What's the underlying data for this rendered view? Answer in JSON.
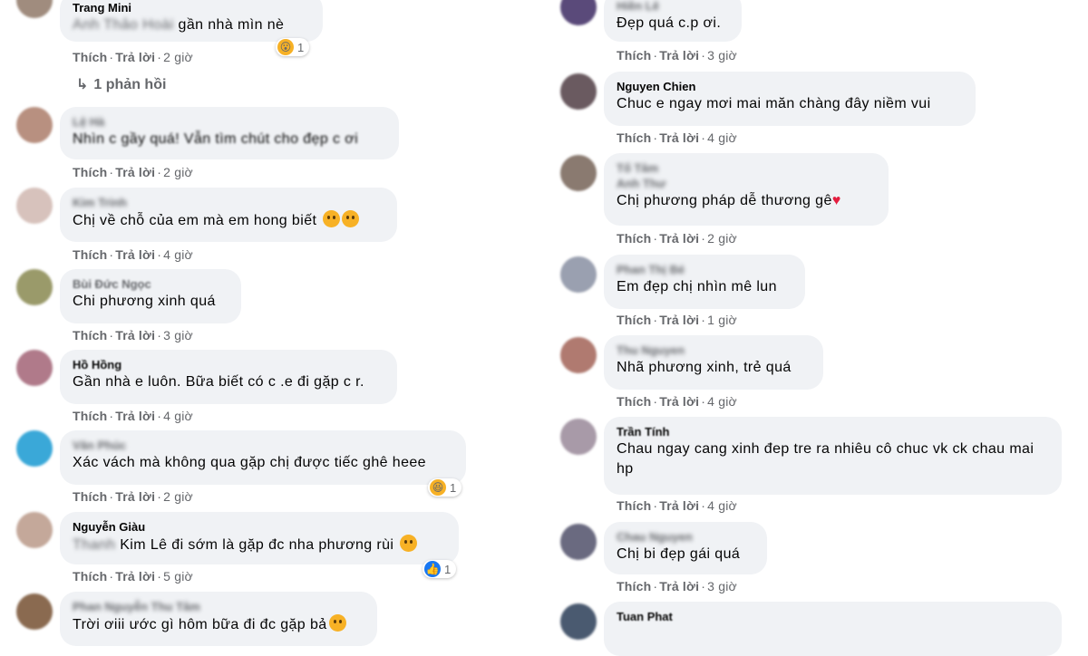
{
  "left": [
    {
      "author": "Trang Mini",
      "text": "gần nhà mìn nè",
      "reaction": {
        "icon": "wow-emoji",
        "count": "1"
      },
      "actions": {
        "like": "Thích",
        "reply": "Trả lời",
        "time": "2 giờ"
      }
    },
    {
      "author": "Lệ Hà",
      "text": "Nhìn c gầy quá! Vẫn tìm chút cho đẹp c ơi",
      "actions": {
        "like": "Thích",
        "reply": "Trả lời",
        "time": "2 giờ"
      }
    },
    {
      "author": "Kim Trinh",
      "text": "Chị về chỗ của em mà em hong biết",
      "actions": {
        "like": "Thích",
        "reply": "Trả lời",
        "time": "4 giờ"
      }
    },
    {
      "author": "Bùi Đức Ngọc",
      "text": "Chi phương xinh quá",
      "actions": {
        "like": "Thích",
        "reply": "Trả lời",
        "time": "3 giờ"
      }
    },
    {
      "author": "Hồ Hồng",
      "text": "Gần nhà e luôn. Bữa biết có c .e đi gặp c r.",
      "actions": {
        "like": "Thích",
        "reply": "Trả lời",
        "time": "4 giờ"
      }
    },
    {
      "author": "Văn Phúc",
      "text": "Xác vách mà không qua gặp chị được tiếc ghê heee",
      "reaction": {
        "icon": "haha-emoji",
        "count": "1"
      },
      "actions": {
        "like": "Thích",
        "reply": "Trả lời",
        "time": "2 giờ"
      }
    },
    {
      "author": "Nguyễn Giàu",
      "text": "Kim Lê đi sớm là gặp đc nha phương rùi",
      "reaction": {
        "icon": "like-emoji",
        "count": "1"
      },
      "actions": {
        "like": "Thích",
        "reply": "Trả lời",
        "time": "5 giờ"
      }
    },
    {
      "author": "Phan Nguyễn Thu Tâm",
      "text": "Trời ơiii ước gì hôm bữa đi đc gặp bả"
    }
  ],
  "reply_link": "1 phản hồi",
  "right": [
    {
      "author": "Hiền Lê",
      "text": "Đẹp quá c.p ơi.",
      "actions": {
        "like": "Thích",
        "reply": "Trả lời",
        "time": "3 giờ"
      }
    },
    {
      "author": "Nguyen Chien",
      "text": "Chuc e ngay mơi mai măn chàng đây niềm vui",
      "actions": {
        "like": "Thích",
        "reply": "Trả lời",
        "time": "4 giờ"
      }
    },
    {
      "author": "Anh Thư",
      "text": "Chị phương pháp dễ thương gê",
      "actions": {
        "like": "Thích",
        "reply": "Trả lời",
        "time": "2 giờ"
      }
    },
    {
      "author": "Phan Thị Bé",
      "text": "Em đẹp chị nhìn mê lun",
      "actions": {
        "like": "Thích",
        "reply": "Trả lời",
        "time": "1 giờ"
      }
    },
    {
      "author": "Thu Nguyen",
      "text": "Nhã phương xinh, trẻ quá",
      "actions": {
        "like": "Thích",
        "reply": "Trả lời",
        "time": "4 giờ"
      }
    },
    {
      "author": "Trần Tính",
      "text": "Chau ngay cang xinh đep tre ra nhiêu cô chuc vk ck chau mai hp",
      "actions": {
        "like": "Thích",
        "reply": "Trả lời",
        "time": "4 giờ"
      }
    },
    {
      "author": "Chau Nguyen",
      "text": "Chị bi đẹp gái quá",
      "actions": {
        "like": "Thích",
        "reply": "Trả lời",
        "time": "3 giờ"
      }
    },
    {
      "author": "Tuan Phat",
      "text": ""
    }
  ],
  "colors": {
    "bubble": "#f0f2f5",
    "meta": "#65676b",
    "text": "#050505",
    "like": "#1877f2",
    "heart": "#e41e3f"
  }
}
